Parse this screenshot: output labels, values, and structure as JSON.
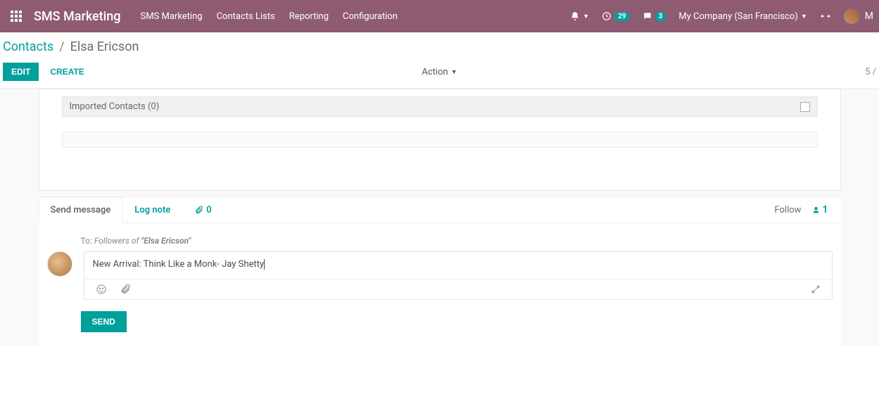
{
  "topbar": {
    "app_title": "SMS Marketing",
    "nav": [
      "SMS Marketing",
      "Contacts Lists",
      "Reporting",
      "Configuration"
    ],
    "activities_badge": "29",
    "discuss_badge": "3",
    "company": "My Company (San Francisco)",
    "user_initial": "M"
  },
  "breadcrumb": {
    "parent": "Contacts",
    "current": "Elsa Ericson"
  },
  "action_bar": {
    "edit": "EDIT",
    "create": "CREATE",
    "action": "Action",
    "pager": "5 /"
  },
  "form": {
    "list_header": "Imported Contacts (0)"
  },
  "chatter": {
    "tabs": {
      "send": "Send message",
      "log": "Log note",
      "attach_count": "0"
    },
    "follow": "Follow",
    "followers": "1",
    "compose": {
      "to_prefix": "To: ",
      "to_followers": "Followers of ",
      "to_name": "\"Elsa Ericson\"",
      "body": "New Arrival: Think Like a Monk- Jay Shetty",
      "send": "SEND"
    }
  }
}
